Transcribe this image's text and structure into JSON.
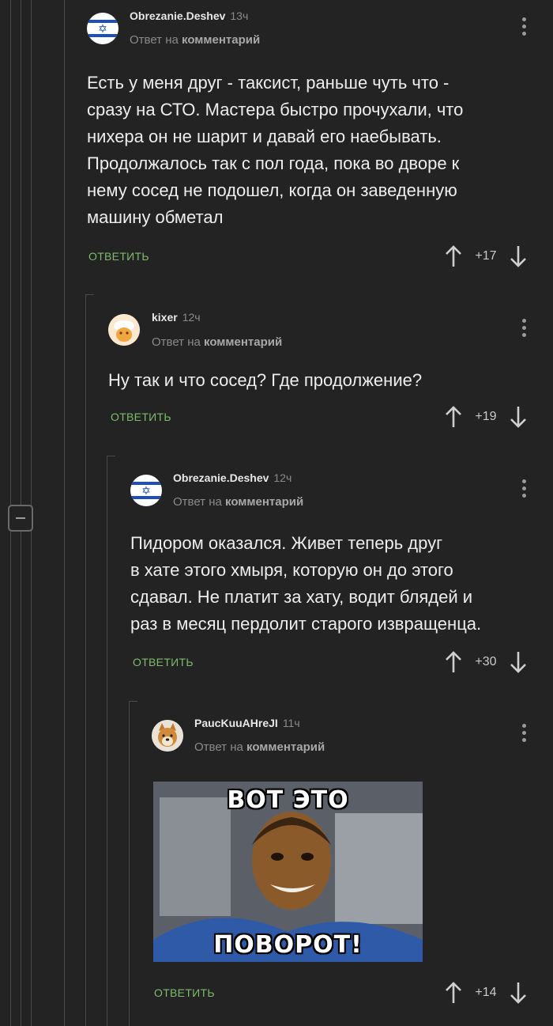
{
  "thread": {
    "comments": [
      {
        "author": "Obrezanie.Deshev",
        "time": "13ч",
        "reply_prefix": "Ответ на",
        "reply_target": "комментарий",
        "body_lines": [
          "Есть у меня друг - таксист, раньше чуть что -",
          "сразу на СТО. Мастера быстро прочухали, что",
          "нихера он не шарит и давай его наебывать.",
          "Продолжалось так с пол года, пока во дворе к",
          "нему сосед не подошел, когда он заведенную",
          "машину обметал"
        ],
        "reply_label": "ОТВЕТИТЬ",
        "score": "+17",
        "avatar_icon": "israel-flag-icon"
      },
      {
        "author": "kixer",
        "time": "12ч",
        "reply_prefix": "Ответ на",
        "reply_target": "комментарий",
        "body_lines": [
          "Ну так и что сосед? Где продолжение?"
        ],
        "reply_label": "ОТВЕТИТЬ",
        "score": "+19",
        "avatar_icon": "cartoon-face-avatar"
      },
      {
        "author": "Obrezanie.Deshev",
        "time": "12ч",
        "reply_prefix": "Ответ на",
        "reply_target": "комментарий",
        "body_lines": [
          "Пидором оказался. Живет теперь друг",
          "в хате этого хмыря, которую он до этого",
          "сдавал. Не платит за хату, водит блядей и",
          "раз в месяц пердолит старого извращенца."
        ],
        "reply_label": "ОТВЕТИТЬ",
        "score": "+30",
        "avatar_icon": "israel-flag-icon"
      },
      {
        "author": "PaucKuuAHreJI",
        "time": "11ч",
        "reply_prefix": "Ответ на",
        "reply_target": "комментарий",
        "image_caption_top": "ВОТ ЭТО",
        "image_caption_bottom": "ПОВОРОТ!",
        "reply_label": "ОТВЕТИТЬ",
        "score": "+14",
        "avatar_icon": "dog-avatar"
      }
    ]
  },
  "colors": {
    "background": "#232323",
    "reply_button": "#7dba6a",
    "muted_text": "#8a8a8a",
    "thread_line": "#4a4a4a"
  }
}
